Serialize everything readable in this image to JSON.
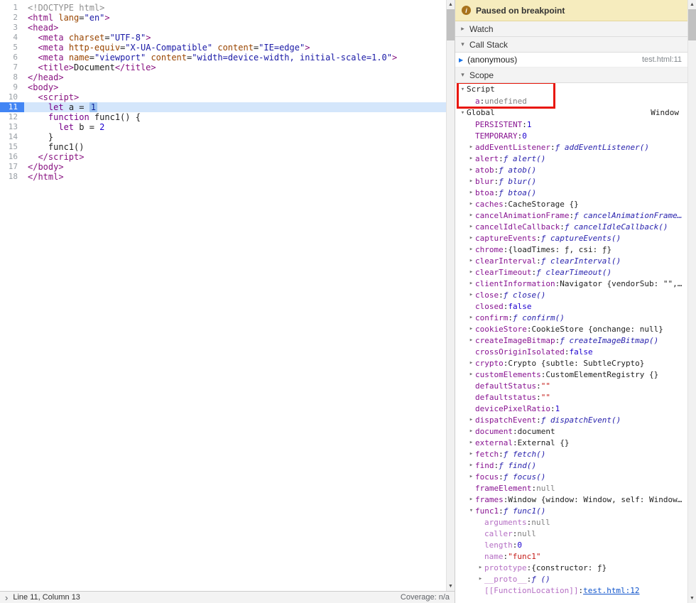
{
  "colors": {
    "accent_blue": "#4285f4",
    "paused_banner_bg": "#f6ecbe",
    "annotation_red": "#e8170b"
  },
  "icons": {
    "up_arrow": "▲",
    "down_arrow": "▼",
    "collapsed": "▸",
    "expanded": "▾",
    "chevron": "›",
    "info": "i",
    "frame_arrow": "▶"
  },
  "editor": {
    "lines": [
      {
        "num": 1,
        "tokens": [
          [
            "d",
            "<!DOCTYPE html>"
          ]
        ]
      },
      {
        "num": 2,
        "tokens": [
          [
            "t",
            "<html"
          ],
          [
            "p",
            " "
          ],
          [
            "a",
            "lang"
          ],
          [
            "p",
            "="
          ],
          [
            "s",
            "\"en\""
          ],
          [
            "t",
            ">"
          ]
        ]
      },
      {
        "num": 3,
        "tokens": [
          [
            "t",
            "<head>"
          ]
        ]
      },
      {
        "num": 4,
        "tokens": [
          [
            "p",
            "  "
          ],
          [
            "t",
            "<meta"
          ],
          [
            "p",
            " "
          ],
          [
            "a",
            "charset"
          ],
          [
            "p",
            "="
          ],
          [
            "s",
            "\"UTF-8\""
          ],
          [
            "t",
            ">"
          ]
        ]
      },
      {
        "num": 5,
        "tokens": [
          [
            "p",
            "  "
          ],
          [
            "t",
            "<meta"
          ],
          [
            "p",
            " "
          ],
          [
            "a",
            "http-equiv"
          ],
          [
            "p",
            "="
          ],
          [
            "s",
            "\"X-UA-Compatible\""
          ],
          [
            "p",
            " "
          ],
          [
            "a",
            "content"
          ],
          [
            "p",
            "="
          ],
          [
            "s",
            "\"IE=edge\""
          ],
          [
            "t",
            ">"
          ]
        ]
      },
      {
        "num": 6,
        "tokens": [
          [
            "p",
            "  "
          ],
          [
            "t",
            "<meta"
          ],
          [
            "p",
            " "
          ],
          [
            "a",
            "name"
          ],
          [
            "p",
            "="
          ],
          [
            "s",
            "\"viewport\""
          ],
          [
            "p",
            " "
          ],
          [
            "a",
            "content"
          ],
          [
            "p",
            "="
          ],
          [
            "s",
            "\"width=device-width, initial-scale=1.0\""
          ],
          [
            "t",
            ">"
          ]
        ]
      },
      {
        "num": 7,
        "tokens": [
          [
            "p",
            "  "
          ],
          [
            "t",
            "<title>"
          ],
          [
            "p",
            "Document"
          ],
          [
            "t",
            "</title>"
          ]
        ]
      },
      {
        "num": 8,
        "tokens": [
          [
            "t",
            "</head>"
          ]
        ]
      },
      {
        "num": 9,
        "tokens": [
          [
            "t",
            "<body>"
          ]
        ]
      },
      {
        "num": 10,
        "tokens": [
          [
            "p",
            "  "
          ],
          [
            "t",
            "<script>"
          ]
        ]
      },
      {
        "num": 11,
        "current": true,
        "tokens": [
          [
            "p",
            "    "
          ],
          [
            "k",
            "let"
          ],
          [
            "p",
            " a = "
          ],
          [
            "ns",
            "1"
          ]
        ]
      },
      {
        "num": 12,
        "tokens": [
          [
            "p",
            "    "
          ],
          [
            "k",
            "function"
          ],
          [
            "p",
            " func1() {"
          ]
        ]
      },
      {
        "num": 13,
        "tokens": [
          [
            "p",
            "      "
          ],
          [
            "k",
            "let"
          ],
          [
            "p",
            " b = "
          ],
          [
            "n",
            "2"
          ]
        ]
      },
      {
        "num": 14,
        "tokens": [
          [
            "p",
            "    }"
          ]
        ]
      },
      {
        "num": 15,
        "tokens": [
          [
            "p",
            "    func1()"
          ]
        ]
      },
      {
        "num": 16,
        "tokens": [
          [
            "p",
            "  "
          ],
          [
            "t",
            "</script>"
          ]
        ]
      },
      {
        "num": 17,
        "tokens": [
          [
            "t",
            "</body>"
          ]
        ]
      },
      {
        "num": 18,
        "tokens": [
          [
            "t",
            "</html>"
          ]
        ]
      }
    ]
  },
  "debugger": {
    "banner": "Paused on breakpoint",
    "watch_label": "Watch",
    "call_stack": {
      "label": "Call Stack",
      "frames": [
        {
          "name": "(anonymous)",
          "location": "test.html:11"
        }
      ]
    },
    "scope": {
      "label": "Scope",
      "groups": [
        {
          "name": "Script",
          "annotated": true,
          "props": [
            {
              "name": "a",
              "value": "undefined",
              "vtype": "undef"
            }
          ]
        },
        {
          "name": "Global",
          "note": "Window",
          "props": [
            {
              "name": "PERSISTENT",
              "value": "1",
              "vtype": "num"
            },
            {
              "name": "TEMPORARY",
              "value": "0",
              "vtype": "num"
            },
            {
              "name": "addEventListener",
              "value": "ƒ addEventListener()",
              "vtype": "fn",
              "expand": "closed"
            },
            {
              "name": "alert",
              "value": "ƒ alert()",
              "vtype": "fn",
              "expand": "closed"
            },
            {
              "name": "atob",
              "value": "ƒ atob()",
              "vtype": "fn",
              "expand": "closed"
            },
            {
              "name": "blur",
              "value": "ƒ blur()",
              "vtype": "fn",
              "expand": "closed"
            },
            {
              "name": "btoa",
              "value": "ƒ btoa()",
              "vtype": "fn",
              "expand": "closed"
            },
            {
              "name": "caches",
              "value": "CacheStorage {}",
              "vtype": "obj",
              "expand": "closed"
            },
            {
              "name": "cancelAnimationFrame",
              "value": "ƒ cancelAnimationFrame…",
              "vtype": "fn",
              "expand": "closed"
            },
            {
              "name": "cancelIdleCallback",
              "value": "ƒ cancelIdleCallback()",
              "vtype": "fn",
              "expand": "closed"
            },
            {
              "name": "captureEvents",
              "value": "ƒ captureEvents()",
              "vtype": "fn",
              "expand": "closed"
            },
            {
              "name": "chrome",
              "value": "{loadTimes: ƒ, csi: ƒ}",
              "vtype": "obj",
              "expand": "closed"
            },
            {
              "name": "clearInterval",
              "value": "ƒ clearInterval()",
              "vtype": "fn",
              "expand": "closed"
            },
            {
              "name": "clearTimeout",
              "value": "ƒ clearTimeout()",
              "vtype": "fn",
              "expand": "closed"
            },
            {
              "name": "clientInformation",
              "value": "Navigator {vendorSub: \"\",…",
              "vtype": "obj",
              "expand": "closed"
            },
            {
              "name": "close",
              "value": "ƒ close()",
              "vtype": "fn",
              "expand": "closed"
            },
            {
              "name": "closed",
              "value": "false",
              "vtype": "bool"
            },
            {
              "name": "confirm",
              "value": "ƒ confirm()",
              "vtype": "fn",
              "expand": "closed"
            },
            {
              "name": "cookieStore",
              "value": "CookieStore {onchange: null}",
              "vtype": "obj",
              "expand": "closed"
            },
            {
              "name": "createImageBitmap",
              "value": "ƒ createImageBitmap()",
              "vtype": "fn",
              "expand": "closed"
            },
            {
              "name": "crossOriginIsolated",
              "value": "false",
              "vtype": "bool"
            },
            {
              "name": "crypto",
              "value": "Crypto {subtle: SubtleCrypto}",
              "vtype": "obj",
              "expand": "closed"
            },
            {
              "name": "customElements",
              "value": "CustomElementRegistry {}",
              "vtype": "obj",
              "expand": "closed"
            },
            {
              "name": "defaultStatus",
              "value": "\"\"",
              "vtype": "str"
            },
            {
              "name": "defaultstatus",
              "value": "\"\"",
              "vtype": "str"
            },
            {
              "name": "devicePixelRatio",
              "value": "1",
              "vtype": "num"
            },
            {
              "name": "dispatchEvent",
              "value": "ƒ dispatchEvent()",
              "vtype": "fn",
              "expand": "closed"
            },
            {
              "name": "document",
              "value": "document",
              "vtype": "obj",
              "expand": "closed"
            },
            {
              "name": "external",
              "value": "External {}",
              "vtype": "obj",
              "expand": "closed"
            },
            {
              "name": "fetch",
              "value": "ƒ fetch()",
              "vtype": "fn",
              "expand": "closed"
            },
            {
              "name": "find",
              "value": "ƒ find()",
              "vtype": "fn",
              "expand": "closed"
            },
            {
              "name": "focus",
              "value": "ƒ focus()",
              "vtype": "fn",
              "expand": "closed"
            },
            {
              "name": "frameElement",
              "value": "null",
              "vtype": "null"
            },
            {
              "name": "frames",
              "value": "Window {window: Window, self: Window…",
              "vtype": "obj",
              "expand": "closed"
            },
            {
              "name": "func1",
              "value": "ƒ func1()",
              "vtype": "fn",
              "expand": "open",
              "children": [
                {
                  "name": "arguments",
                  "value": "null",
                  "vtype": "null",
                  "dim": true
                },
                {
                  "name": "caller",
                  "value": "null",
                  "vtype": "null",
                  "dim": true
                },
                {
                  "name": "length",
                  "value": "0",
                  "vtype": "num",
                  "dim": true
                },
                {
                  "name": "name",
                  "value": "\"func1\"",
                  "vtype": "str",
                  "dim": true
                },
                {
                  "name": "prototype",
                  "value": "{constructor: ƒ}",
                  "vtype": "obj",
                  "expand": "closed",
                  "dim": true
                },
                {
                  "name": "__proto__",
                  "value": "ƒ ()",
                  "vtype": "fn",
                  "expand": "closed",
                  "dim": true
                },
                {
                  "name": "[[FunctionLocation]]",
                  "value": "test.html:12",
                  "vtype": "link",
                  "dim": true
                }
              ]
            }
          ]
        }
      ]
    }
  },
  "status_bar": {
    "position": "Line 11, Column 13",
    "coverage": "Coverage: n/a"
  }
}
